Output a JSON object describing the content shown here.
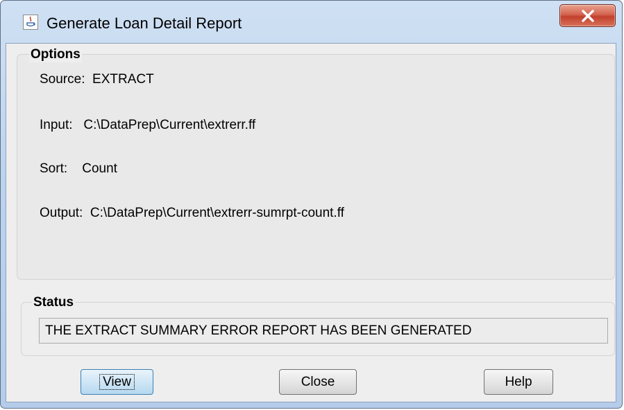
{
  "window": {
    "title": "Generate Loan Detail Report",
    "icon": "java-cup-icon",
    "close_icon": "close-x-icon"
  },
  "options": {
    "heading": "Options",
    "source": "Source:  EXTRACT",
    "input": "Input:   C:\\DataPrep\\Current\\extrerr.ff",
    "sort": "Sort:    Count",
    "output": "Output:  C:\\DataPrep\\Current\\extrerr-sumrpt-count.ff"
  },
  "status": {
    "heading": "Status",
    "message": "THE EXTRACT SUMMARY ERROR REPORT HAS BEEN GENERATED"
  },
  "buttons": {
    "view": "View",
    "close": "Close",
    "help": "Help"
  },
  "colors": {
    "titlebar": "#bcd3ee",
    "close_button": "#c2402d",
    "client_bg": "#eeeeee"
  }
}
